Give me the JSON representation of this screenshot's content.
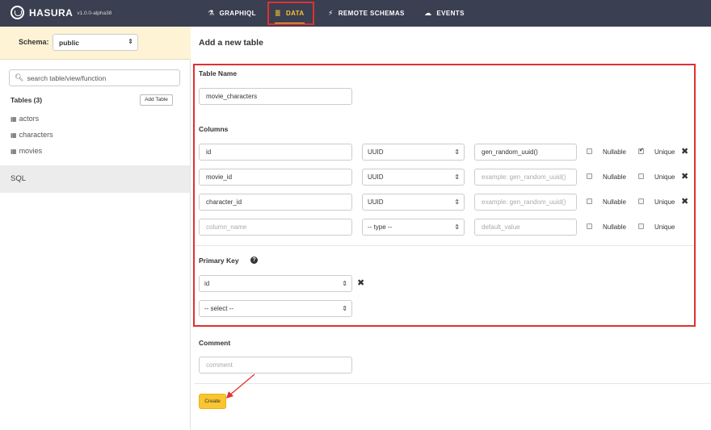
{
  "app": {
    "name": "HASURA",
    "version": "v1.0.0-alpha38"
  },
  "nav": {
    "tabs": [
      {
        "label": "GRAPHIQL",
        "icon": "flask-icon"
      },
      {
        "label": "DATA",
        "icon": "database-icon",
        "active": true
      },
      {
        "label": "REMOTE SCHEMAS",
        "icon": "plug-icon"
      },
      {
        "label": "EVENTS",
        "icon": "cloud-icon"
      }
    ]
  },
  "sidebar": {
    "schema_label": "Schema:",
    "schema_value": "public",
    "search_placeholder": "search table/view/function",
    "tables_title": "Tables (3)",
    "add_table_label": "Add Table",
    "tables": [
      "actors",
      "characters",
      "movies"
    ],
    "sql_label": "SQL"
  },
  "main": {
    "title": "Add a new table",
    "table_name_label": "Table Name",
    "table_name_value": "movie_characters",
    "columns_label": "Columns",
    "nullable_label": "Nullable",
    "unique_label": "Unique",
    "columns": [
      {
        "name": "id",
        "type": "UUID",
        "default": "gen_random_uuid()",
        "default_is_placeholder": false,
        "nullable": false,
        "unique": true,
        "removable": true
      },
      {
        "name": "movie_id",
        "type": "UUID",
        "default": "example: gen_random_uuid()",
        "default_is_placeholder": true,
        "nullable": false,
        "unique": false,
        "removable": true
      },
      {
        "name": "character_id",
        "type": "UUID",
        "default": "example: gen_random_uuid()",
        "default_is_placeholder": true,
        "nullable": false,
        "unique": false,
        "removable": true
      },
      {
        "name": "column_name",
        "name_is_placeholder": true,
        "type": "-- type --",
        "default": "default_value",
        "default_is_placeholder": true,
        "nullable": false,
        "unique": false,
        "removable": false
      }
    ],
    "primary_key_label": "Primary Key",
    "primary_keys": [
      "id",
      "-- select --"
    ],
    "comment_label": "Comment",
    "comment_placeholder": "comment",
    "create_label": "Create"
  },
  "colors": {
    "nav_bg": "#3a3f51",
    "accent": "#f9c530",
    "highlight": "#e0312f",
    "schema_bar_bg": "#fff3d5"
  }
}
